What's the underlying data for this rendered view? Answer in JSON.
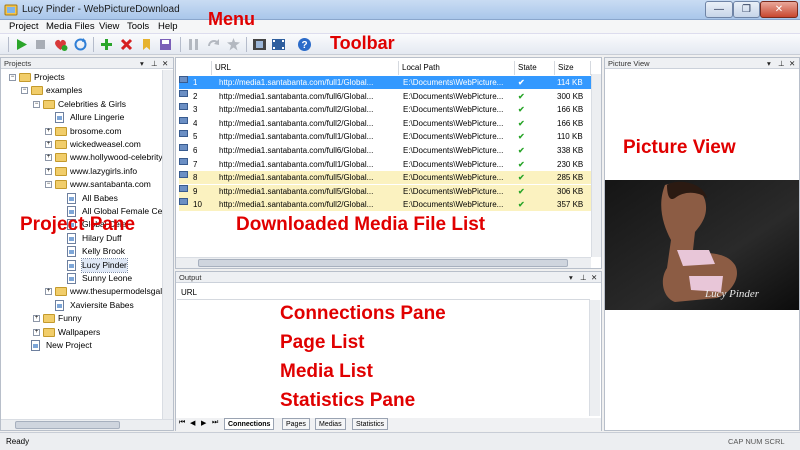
{
  "window": {
    "title": "Lucy Pinder - WebPictureDownload",
    "minimize": "—",
    "maximize": "❐",
    "close": "✕"
  },
  "menu": [
    "Project",
    "Media Files",
    "View",
    "Tools",
    "Help"
  ],
  "toolbar_icons": [
    "start-icon",
    "stop-icon",
    "add-favorite-icon",
    "refresh-icon",
    "add-icon",
    "delete-icon",
    "bookmark-icon",
    "save-icon",
    "pause-icon",
    "redo-icon",
    "settings-icon",
    "film-icon",
    "video-icon",
    "help-icon"
  ],
  "annotations": {
    "menu": "Menu",
    "toolbar": "Toolbar",
    "picture_view": "Picture View",
    "project_pane": "Project Pane",
    "media_list": "Downloaded Media File List",
    "connections": "Connections Pane",
    "page_list": "Page List",
    "media_list2": "Media List",
    "statistics": "Statistics Pane"
  },
  "projects_pane": {
    "title": "Projects",
    "tree": [
      {
        "label": "Projects"
      },
      {
        "label": "examples"
      },
      {
        "label": "Celebrities & Girls"
      },
      {
        "label": "Allure Lingerie"
      },
      {
        "label": "brosome.com"
      },
      {
        "label": "wickedweasel.com"
      },
      {
        "label": "www.hollywood-celebrity-"
      },
      {
        "label": "www.lazygirls.info"
      },
      {
        "label": "www.santabanta.com"
      },
      {
        "label": "All Babes"
      },
      {
        "label": "All Global Female Cele"
      },
      {
        "label": "Global Cele"
      },
      {
        "label": "Hilary Duff"
      },
      {
        "label": "Kelly Brook"
      },
      {
        "label": "Lucy Pinder"
      },
      {
        "label": "Sunny Leone"
      },
      {
        "label": "www.thesupermodelsgalle"
      },
      {
        "label": "Xaviersite Babes"
      },
      {
        "label": "Funny"
      },
      {
        "label": "Wallpapers"
      },
      {
        "label": "New Project"
      }
    ]
  },
  "media_list": {
    "columns": [
      "URL",
      "Local Path",
      "State",
      "Size"
    ],
    "rows": [
      {
        "num": "1",
        "url": "http://media1.santabanta.com/full1/Global...",
        "path": "E:\\Documents\\WebPicture...",
        "size": "114 KB"
      },
      {
        "num": "2",
        "url": "http://media1.santabanta.com/full6/Global...",
        "path": "E:\\Documents\\WebPicture...",
        "size": "300 KB"
      },
      {
        "num": "3",
        "url": "http://media1.santabanta.com/full2/Global...",
        "path": "E:\\Documents\\WebPicture...",
        "size": "166 KB"
      },
      {
        "num": "4",
        "url": "http://media1.santabanta.com/full2/Global...",
        "path": "E:\\Documents\\WebPicture...",
        "size": "166 KB"
      },
      {
        "num": "5",
        "url": "http://media1.santabanta.com/full1/Global...",
        "path": "E:\\Documents\\WebPicture...",
        "size": "110 KB"
      },
      {
        "num": "6",
        "url": "http://media1.santabanta.com/full6/Global...",
        "path": "E:\\Documents\\WebPicture...",
        "size": "338 KB"
      },
      {
        "num": "7",
        "url": "http://media1.santabanta.com/full1/Global...",
        "path": "E:\\Documents\\WebPicture...",
        "size": "230 KB"
      },
      {
        "num": "8",
        "url": "http://media1.santabanta.com/full5/Global...",
        "path": "E:\\Documents\\WebPicture...",
        "size": "285 KB"
      },
      {
        "num": "9",
        "url": "http://media1.santabanta.com/full5/Global...",
        "path": "E:\\Documents\\WebPicture...",
        "size": "306 KB"
      },
      {
        "num": "10",
        "url": "http://media1.santabanta.com/full2/Global...",
        "path": "E:\\Documents\\WebPicture...",
        "size": "357 KB"
      }
    ],
    "state_glyph": "✔"
  },
  "output_pane": {
    "title": "Output",
    "column": "URL",
    "tabs": [
      "Connections",
      "Pages",
      "Medias",
      "Statistics"
    ],
    "nav": [
      "⏮",
      "◀",
      "▶",
      "⏭"
    ]
  },
  "picture_pane": {
    "title": "Picture View",
    "signature": "Lucy Pinder"
  },
  "status": {
    "text": "Ready",
    "indicators": "CAP  NUM  SCRL"
  },
  "colors": {
    "selected_row": "#3399ff",
    "highlight_row": "#fbf2c0",
    "annotation": "#e00000",
    "check": "#2aa52a"
  }
}
